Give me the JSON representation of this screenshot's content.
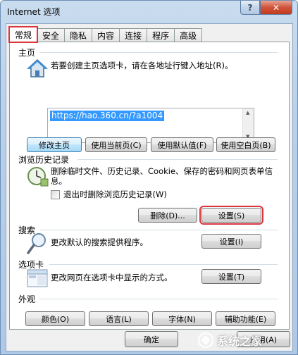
{
  "window": {
    "title": "Internet 选项",
    "help_label": "?",
    "close_label": "✕"
  },
  "tabs": [
    {
      "label": "常规"
    },
    {
      "label": "安全"
    },
    {
      "label": "隐私"
    },
    {
      "label": "内容"
    },
    {
      "label": "连接"
    },
    {
      "label": "程序"
    },
    {
      "label": "高级"
    }
  ],
  "home": {
    "heading": "主页",
    "desc": "若要创建主页选项卡，请在各地址行键入地址(R)。",
    "url": "https://hao.360.cn/?a1004",
    "buttons": {
      "current": "修改主页",
      "use_current": "使用当前页(C)",
      "use_default": "使用默认值(F)",
      "use_blank": "使用空白页(B)"
    }
  },
  "history": {
    "heading": "浏览历史记录",
    "desc": "删除临时文件、历史记录、Cookie、保存的密码和网页表单信息。",
    "checkbox_label": "退出时删除浏览历史记录(W)",
    "delete_label": "删除(D)...",
    "settings_label": "设置(S)"
  },
  "search": {
    "heading": "搜索",
    "desc": "更改默认的搜索提供程序。",
    "settings_label": "设置(I)"
  },
  "tabs_section": {
    "heading": "选项卡",
    "desc": "更改网页在选项卡中显示的方式。",
    "settings_label": "设置(T)"
  },
  "appearance": {
    "heading": "外观",
    "colors_label": "颜色(O)",
    "languages_label": "语言(L)",
    "fonts_label": "字体(N)",
    "accessibility_label": "辅助功能(E)"
  },
  "footer": {
    "ok_label": "确定",
    "apply_label": "应用(A)"
  },
  "watermark": {
    "text": "系统之家"
  },
  "colors": {
    "highlight": "#d9363e",
    "selection": "#3399ff",
    "close": "#c23a1f"
  }
}
